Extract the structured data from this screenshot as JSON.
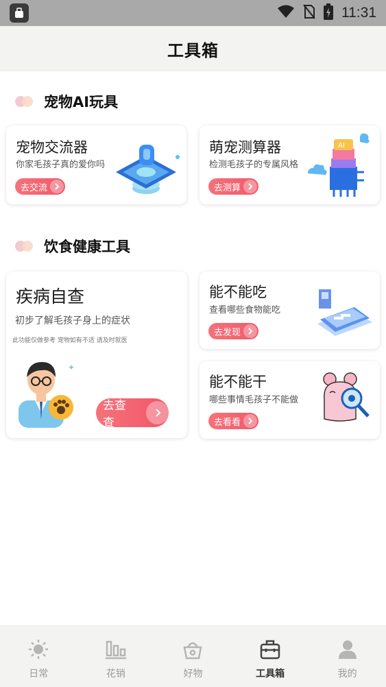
{
  "status_bar": {
    "time": "11:31"
  },
  "header": {
    "title": "工具箱"
  },
  "sections": {
    "ai": {
      "title": "宠物AI玩具"
    },
    "diet": {
      "title": "饮食健康工具"
    }
  },
  "cards": {
    "translator": {
      "title": "宠物交流器",
      "subtitle": "你家毛孩子真的爱你吗",
      "button": "去交流"
    },
    "calculator": {
      "title": "萌宠测算器",
      "subtitle": "检测毛孩子的专属风格",
      "button": "去测算"
    },
    "checkup": {
      "title": "疾病自查",
      "subtitle": "初步了解毛孩子身上的症状",
      "note": "此功能仅做参考 宠物如有不适 请及时就医",
      "button": "去查查"
    },
    "can_eat": {
      "title": "能不能吃",
      "subtitle": "查看哪些食物能吃",
      "button": "去发现"
    },
    "can_do": {
      "title": "能不能干",
      "subtitle": "哪些事情毛孩子不能做",
      "button": "去看看"
    }
  },
  "tabs": [
    {
      "label": "日常",
      "icon": "sun-icon"
    },
    {
      "label": "花销",
      "icon": "bar-chart-icon"
    },
    {
      "label": "好物",
      "icon": "basket-icon"
    },
    {
      "label": "工具箱",
      "icon": "toolbox-icon"
    },
    {
      "label": "我的",
      "icon": "person-icon"
    }
  ],
  "colors": {
    "accent": "#f05a6a",
    "active_tab": "#333333",
    "inactive_tab": "#9a9a9a"
  }
}
